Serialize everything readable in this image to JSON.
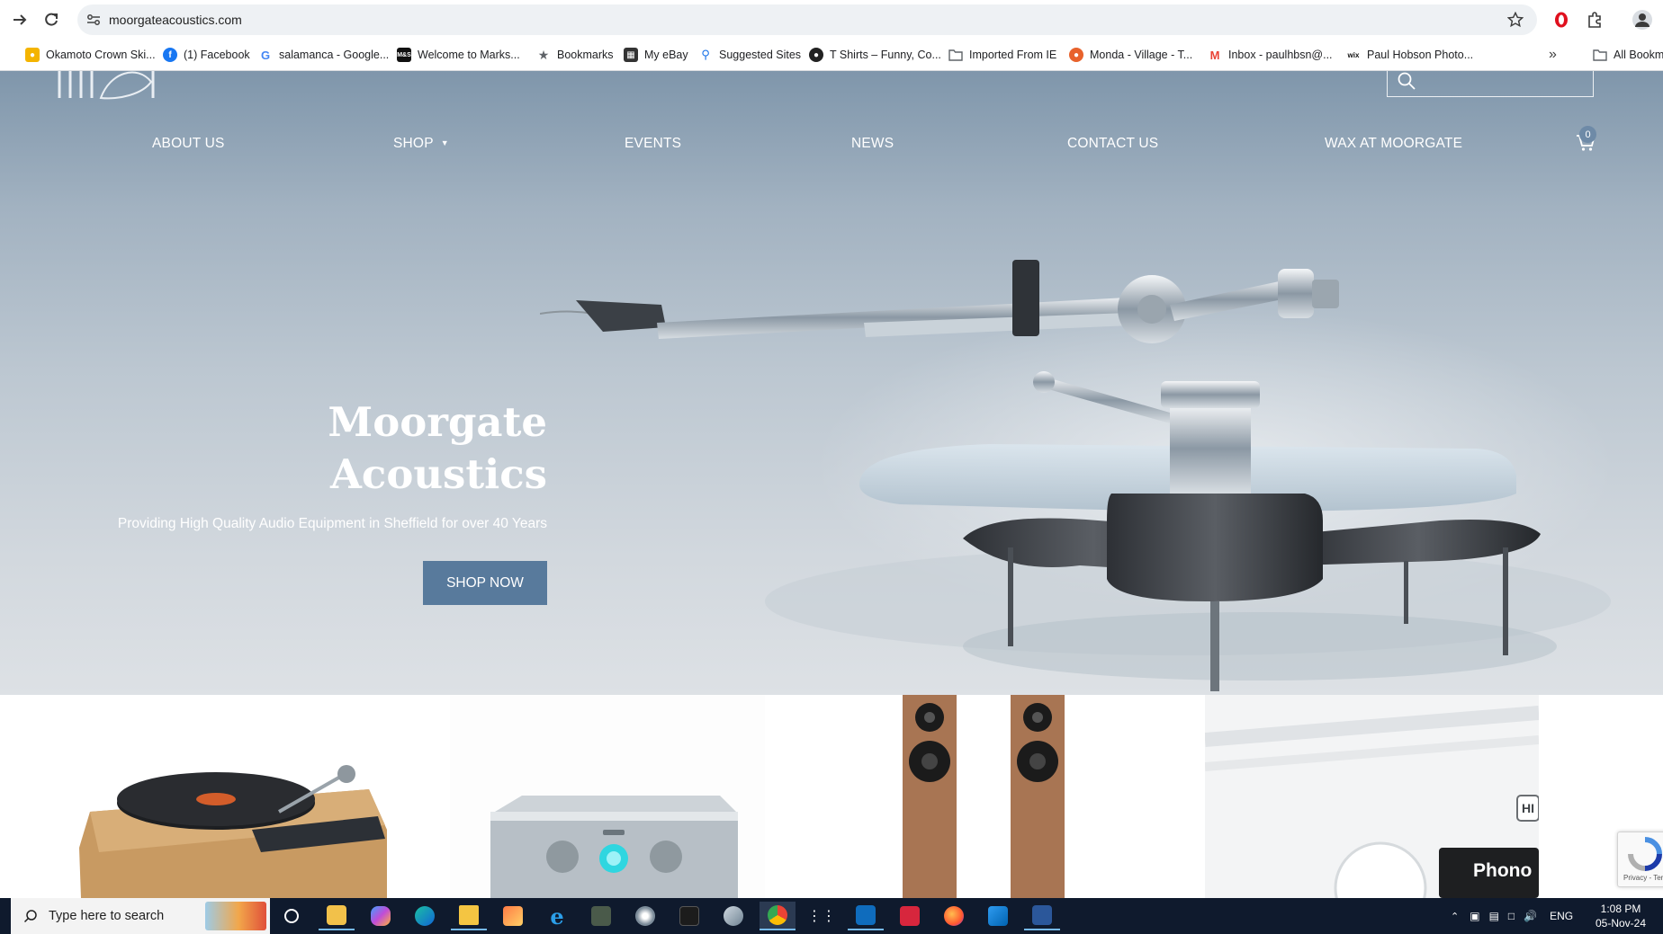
{
  "browser": {
    "url": "moorgateacoustics.com",
    "bookmarks": [
      {
        "label": "Okamoto Crown Ski...",
        "icon": "bell-icon",
        "color": "#f4b400"
      },
      {
        "label": "(1) Facebook",
        "icon": "facebook-icon",
        "color": "#1877f2"
      },
      {
        "label": "salamanca - Google...",
        "icon": "google-icon",
        "color": "#4285f4"
      },
      {
        "label": "Welcome to Marks...",
        "icon": "ms-icon",
        "color": "#111111"
      },
      {
        "label": "Bookmarks",
        "icon": "star-icon",
        "color": "#5f6368"
      },
      {
        "label": "My eBay",
        "icon": "bag-icon",
        "color": "#333333"
      },
      {
        "label": "Suggested Sites",
        "icon": "search-icon",
        "color": "#1a73e8"
      },
      {
        "label": "T Shirts – Funny, Co...",
        "icon": "tshirt-icon",
        "color": "#222222"
      },
      {
        "label": "Imported From IE",
        "icon": "folder-icon",
        "color": "#5f6368"
      },
      {
        "label": "Monda - Village - T...",
        "icon": "monda-icon",
        "color": "#e8622c"
      },
      {
        "label": "Inbox - paulhbsn@...",
        "icon": "gmail-icon",
        "color": "#ea4335"
      },
      {
        "label": "Paul Hobson Photo...",
        "icon": "wix-icon",
        "color": "#111111"
      }
    ],
    "all_bookmarks": "All Bookmarks"
  },
  "site": {
    "nav": [
      {
        "label": "ABOUT US"
      },
      {
        "label": "SHOP"
      },
      {
        "label": "EVENTS"
      },
      {
        "label": "NEWS"
      },
      {
        "label": "CONTACT US"
      },
      {
        "label": "WAX AT MOORGATE"
      }
    ],
    "cart_count": "0",
    "hero": {
      "title_line1": "Moorgate",
      "title_line2": "Acoustics",
      "subtitle": "Providing High Quality Audio Equipment in Sheffield for over 40 Years",
      "cta": "SHOP NOW"
    },
    "products": {
      "amp_label": "Phono",
      "amp_badge": "HI"
    },
    "recaptcha": "Privacy - Terms"
  },
  "taskbar": {
    "search_placeholder": "Type here to search",
    "language": "ENG",
    "time": "1:08 PM",
    "date": "05-Nov-24"
  },
  "colors": {
    "button": "#587a9c",
    "hero_top": "#7f96ab",
    "taskbar": "#0f1a2d"
  }
}
